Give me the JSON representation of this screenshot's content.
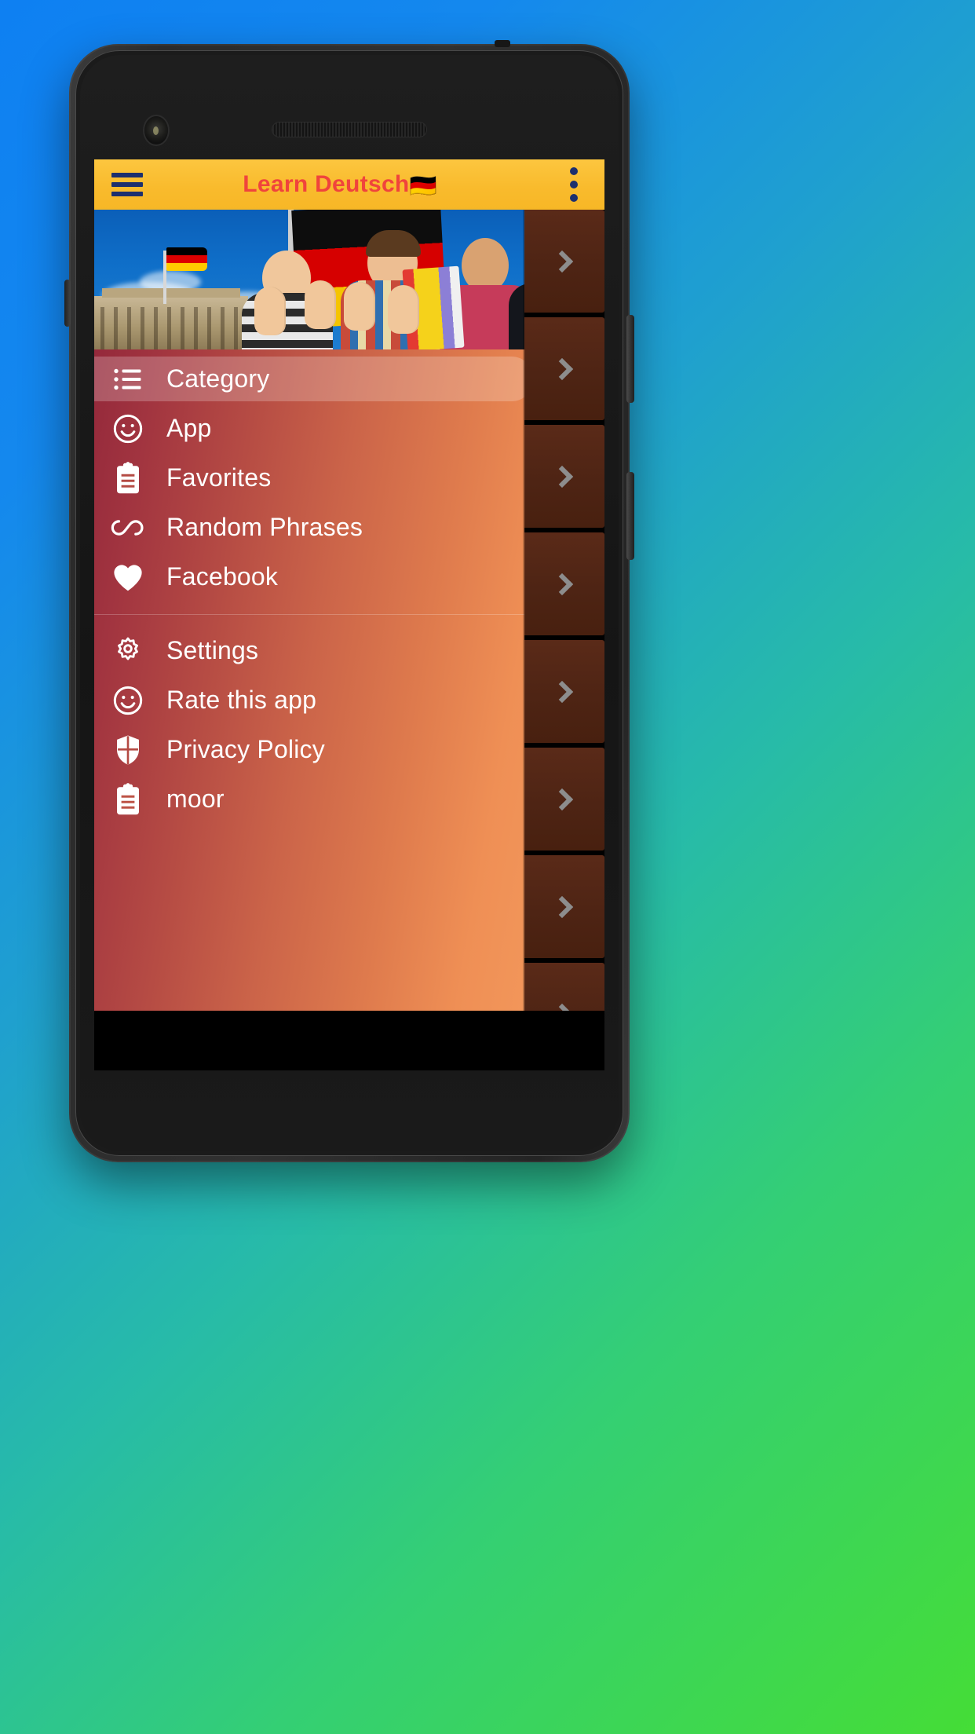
{
  "app": {
    "toolbar": {
      "menu_icon": "hamburger-menu-icon",
      "title": "Learn Deutsch",
      "title_flag": "🇩🇪",
      "overflow_icon": "more-vertical-icon"
    },
    "drawer": {
      "header_image_alt": "students-with-german-flags-banner",
      "items": [
        {
          "label": "Category",
          "icon": "list-icon",
          "selected": true
        },
        {
          "label": "App",
          "icon": "smiley-icon",
          "selected": false
        },
        {
          "label": "Favorites",
          "icon": "clipboard-icon",
          "selected": false
        },
        {
          "label": "Random Phrases",
          "icon": "infinity-icon",
          "selected": false
        },
        {
          "label": "Facebook",
          "icon": "heart-icon",
          "selected": false
        }
      ],
      "items_secondary": [
        {
          "label": "Settings",
          "icon": "gear-icon",
          "selected": false
        },
        {
          "label": "Rate this app",
          "icon": "smiley-icon",
          "selected": false
        },
        {
          "label": "Privacy Policy",
          "icon": "shield-icon",
          "selected": false
        },
        {
          "label": "moor",
          "icon": "clipboard-icon",
          "selected": false
        }
      ]
    },
    "background_list": {
      "row_count": 8,
      "chevron_icon": "chevron-right-icon"
    }
  },
  "colors": {
    "toolbar_bg": "#f9bb2d",
    "toolbar_title": "#f0443c",
    "toolbar_icon": "#1d2f6e",
    "drawer_gradient_start": "#8f2439",
    "drawer_gradient_end": "#f2965a",
    "drawer_text": "#ffffff",
    "list_row_bg": "#4e2414",
    "chevron": "#8d8d8d",
    "wallpaper_start": "#0e80f2",
    "wallpaper_end": "#45dd36"
  }
}
